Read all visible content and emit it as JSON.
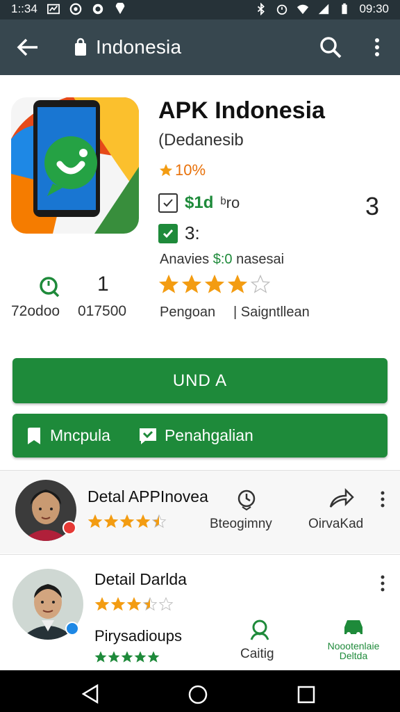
{
  "status_bar": {
    "time": "1::34",
    "clock": "09:30"
  },
  "app_bar": {
    "title": "Indonesia"
  },
  "app": {
    "title": "APK Indonesia",
    "developer": "(Dedanesib",
    "rating_text": "10%",
    "price": "$1d",
    "price_extra": "ᵇro",
    "check2_text": "3:",
    "side_number": "3",
    "availability_prefix": "Anavies",
    "availability_price": "$:0",
    "availability_suffix": "nasesai",
    "stat_number": "1",
    "stat_label_1": "72odoo",
    "stat_label_2": "017500",
    "stars": 4,
    "tag_1": "Pengoan",
    "tag_2": "| Saigntllean"
  },
  "buttons": {
    "install": "UND A",
    "action_1": "Mncpula",
    "action_2": "Penahgalian"
  },
  "cards": [
    {
      "name": "Detal APPInovea",
      "rating": 4.5,
      "middle_label": "Bteogimny",
      "right_label": "OirvaKad"
    },
    {
      "name": "Detail Darlda",
      "rating": 3.5,
      "sub_label": "Pirysadioups",
      "middle_label": "Caitig",
      "right_label_1": "Noootenlaie",
      "right_label_2": "Deltda"
    }
  ],
  "colors": {
    "primary_green": "#1e8a3a",
    "appbar": "#37474f",
    "status": "#263238",
    "star": "#f39c12"
  }
}
